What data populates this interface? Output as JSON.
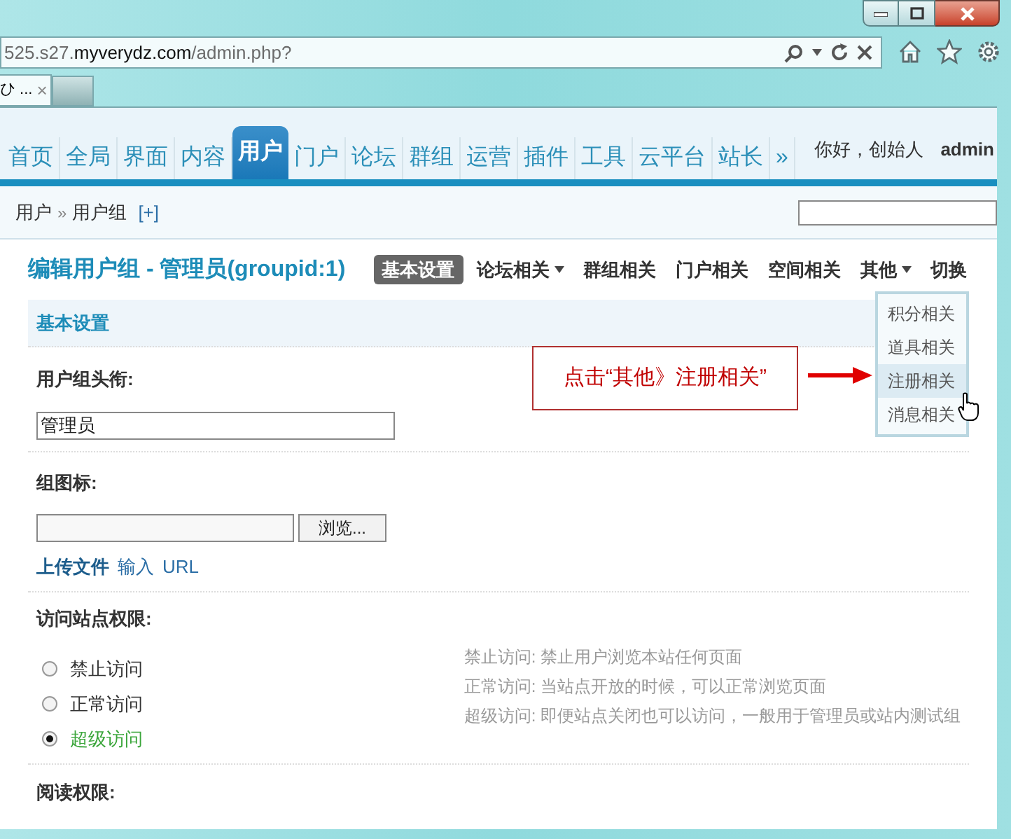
{
  "window_controls": [
    {
      "kind": "minimize"
    },
    {
      "kind": "maximize"
    },
    {
      "kind": "close"
    }
  ],
  "address_bar": {
    "prefix": "525.s27.",
    "host": "myverydz.com",
    "path": "/admin.php?"
  },
  "browser_tab": {
    "title": "ひ ...",
    "close": "×"
  },
  "nav_tabs": [
    {
      "label": "首页",
      "selected": false
    },
    {
      "label": "全局",
      "selected": false
    },
    {
      "label": "界面",
      "selected": false
    },
    {
      "label": "内容",
      "selected": false
    },
    {
      "label": "用户",
      "selected": true
    },
    {
      "label": "门户",
      "selected": false
    },
    {
      "label": "论坛",
      "selected": false
    },
    {
      "label": "群组",
      "selected": false
    },
    {
      "label": "运营",
      "selected": false
    },
    {
      "label": "插件",
      "selected": false
    },
    {
      "label": "工具",
      "selected": false
    },
    {
      "label": "云平台",
      "selected": false
    },
    {
      "label": "站长",
      "selected": false
    },
    {
      "label": "»",
      "selected": false
    }
  ],
  "greeting": "你好，创始人",
  "username": "admin",
  "breadcrumb": [
    "用户",
    "»",
    "用户组"
  ],
  "add_link": "[+]",
  "page_title": "编辑用户组 - 管理员(groupid:1)",
  "sub_nav": [
    {
      "label": "基本设置",
      "selected": true,
      "dropdown": false
    },
    {
      "label": "论坛相关",
      "selected": false,
      "dropdown": true
    },
    {
      "label": "群组相关",
      "selected": false,
      "dropdown": false
    },
    {
      "label": "门户相关",
      "selected": false,
      "dropdown": false
    },
    {
      "label": "空间相关",
      "selected": false,
      "dropdown": false
    },
    {
      "label": "其他",
      "selected": false,
      "dropdown": true
    },
    {
      "label": "切换",
      "selected": false,
      "dropdown": false
    }
  ],
  "dropdown_menu": [
    {
      "label": "积分相关",
      "selected": false
    },
    {
      "label": "道具相关",
      "selected": false
    },
    {
      "label": "注册相关",
      "selected": true
    },
    {
      "label": "消息相关",
      "selected": false
    }
  ],
  "callout": "点击“其他》注册相关”",
  "section_title": "基本设置",
  "title_field": {
    "label": "用户组头衔:",
    "value": "管理员"
  },
  "icon_field": {
    "label": "组图标:",
    "browse": "浏览...",
    "links": [
      {
        "label": "上传文件",
        "selected": true
      },
      {
        "label": "输入",
        "selected": false
      },
      {
        "label": "URL",
        "selected": false
      }
    ]
  },
  "access": {
    "label": "访问站点权限:",
    "options": [
      {
        "label": "禁止访问",
        "checked": false
      },
      {
        "label": "正常访问",
        "checked": false
      },
      {
        "label": "超级访问",
        "checked": true
      }
    ],
    "notes": [
      "禁止访问: 禁止用户浏览本站任何页面",
      "正常访问: 当站点开放的时候，可以正常浏览页面",
      "超级访问: 即便站点关闭也可以访问，一般用于管理员或站内测试组"
    ]
  },
  "read_label": "阅读权限:"
}
